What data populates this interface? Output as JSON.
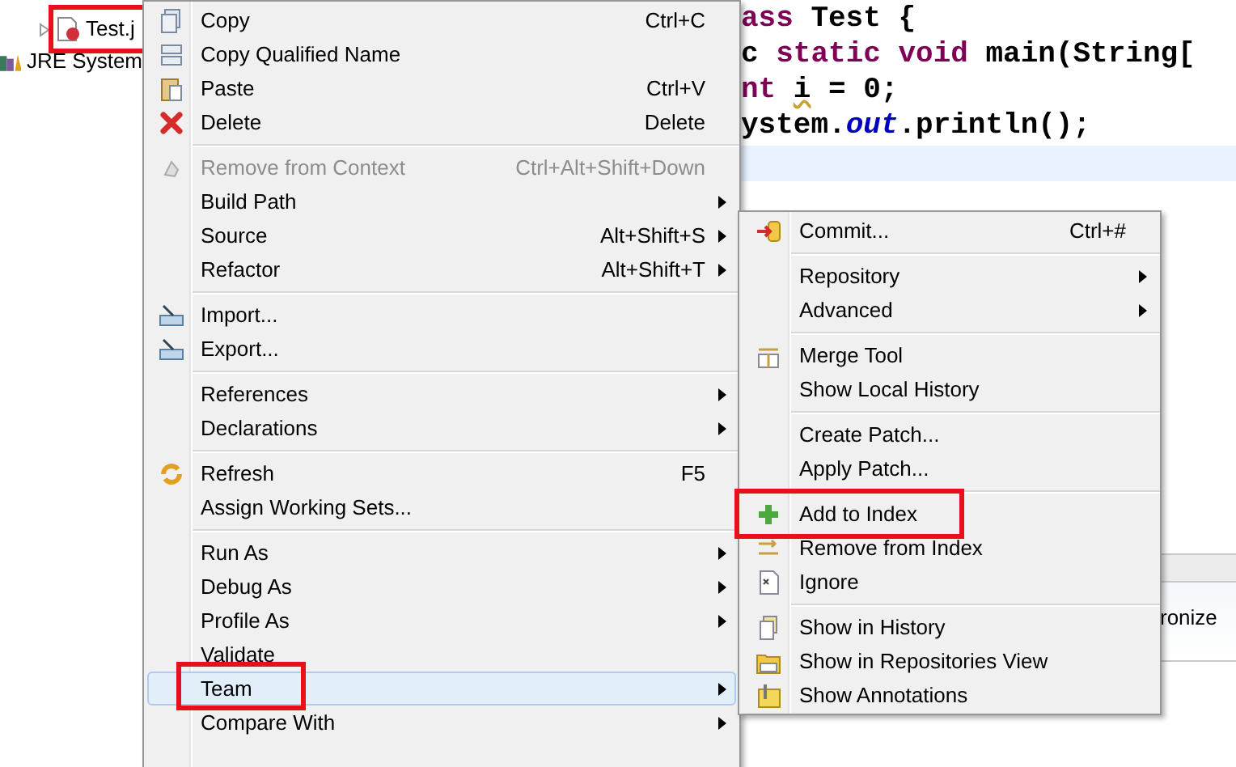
{
  "tree": {
    "items": [
      {
        "label": "Test.j",
        "annotated": true,
        "expandable": true
      },
      {
        "label": "JRE System",
        "annotated": false,
        "expandable": false
      }
    ]
  },
  "editor": {
    "lines": [
      {
        "current": false,
        "segments": [
          {
            "text": "ass",
            "kind": "keyword"
          },
          {
            "text": " Test {",
            "kind": "plain"
          }
        ]
      },
      {
        "current": false,
        "segments": [
          {
            "text": "c ",
            "kind": "plain"
          },
          {
            "text": "static void",
            "kind": "keyword"
          },
          {
            "text": " main(String[",
            "kind": "plain"
          }
        ]
      },
      {
        "current": false,
        "segments": [
          {
            "text": "nt ",
            "kind": "keyword"
          },
          {
            "text": "i",
            "kind": "warning"
          },
          {
            "text": " = 0;",
            "kind": "plain"
          }
        ]
      },
      {
        "current": false,
        "segments": [
          {
            "text": "ystem.",
            "kind": "plain"
          },
          {
            "text": "out",
            "kind": "field"
          },
          {
            "text": ".println();",
            "kind": "plain"
          }
        ]
      },
      {
        "current": true
      }
    ]
  },
  "bottom_panel": {
    "text": "ronize"
  },
  "context_menu": {
    "groups": [
      [
        {
          "label": "Copy",
          "shortcut": "Ctrl+C",
          "has_submenu": false,
          "disabled": false,
          "selected": false,
          "annotated": false
        },
        {
          "label": "Copy Qualified Name",
          "has_submenu": false,
          "disabled": false,
          "selected": false,
          "annotated": false
        },
        {
          "label": "Paste",
          "shortcut": "Ctrl+V",
          "has_submenu": false,
          "disabled": false,
          "selected": false,
          "annotated": false
        },
        {
          "label": "Delete",
          "shortcut": "Delete",
          "has_submenu": false,
          "disabled": false,
          "selected": false,
          "annotated": false
        }
      ],
      [
        {
          "label": "Remove from Context",
          "shortcut": "Ctrl+Alt+Shift+Down",
          "has_submenu": false,
          "disabled": true,
          "selected": false,
          "annotated": false
        },
        {
          "label": "Build Path",
          "has_submenu": true,
          "disabled": false,
          "selected": false,
          "annotated": false
        },
        {
          "label": "Source",
          "shortcut": "Alt+Shift+S",
          "has_submenu": true,
          "disabled": false,
          "selected": false,
          "annotated": false
        },
        {
          "label": "Refactor",
          "shortcut": "Alt+Shift+T",
          "has_submenu": true,
          "disabled": false,
          "selected": false,
          "annotated": false
        }
      ],
      [
        {
          "label": "Import...",
          "has_submenu": false,
          "disabled": false,
          "selected": false,
          "annotated": false
        },
        {
          "label": "Export...",
          "has_submenu": false,
          "disabled": false,
          "selected": false,
          "annotated": false
        }
      ],
      [
        {
          "label": "References",
          "has_submenu": true,
          "disabled": false,
          "selected": false,
          "annotated": false
        },
        {
          "label": "Declarations",
          "has_submenu": true,
          "disabled": false,
          "selected": false,
          "annotated": false
        }
      ],
      [
        {
          "label": "Refresh",
          "shortcut": "F5",
          "has_submenu": false,
          "disabled": false,
          "selected": false,
          "annotated": false
        },
        {
          "label": "Assign Working Sets...",
          "has_submenu": false,
          "disabled": false,
          "selected": false,
          "annotated": false
        }
      ],
      [
        {
          "label": "Run As",
          "has_submenu": true,
          "disabled": false,
          "selected": false,
          "annotated": false
        },
        {
          "label": "Debug As",
          "has_submenu": true,
          "disabled": false,
          "selected": false,
          "annotated": false
        },
        {
          "label": "Profile As",
          "has_submenu": true,
          "disabled": false,
          "selected": false,
          "annotated": false
        },
        {
          "label": "Validate",
          "has_submenu": false,
          "disabled": false,
          "selected": false,
          "annotated": false
        },
        {
          "label": "Team",
          "has_submenu": true,
          "disabled": false,
          "selected": true,
          "annotated": true
        },
        {
          "label": "Compare With",
          "has_submenu": true,
          "disabled": false,
          "selected": false,
          "annotated": false
        }
      ]
    ]
  },
  "team_submenu": {
    "groups": [
      [
        {
          "label": "Commit...",
          "shortcut": "Ctrl+#",
          "has_submenu": false,
          "annotated": false
        }
      ],
      [
        {
          "label": "Repository",
          "has_submenu": true,
          "annotated": false
        },
        {
          "label": "Advanced",
          "has_submenu": true,
          "annotated": false
        }
      ],
      [
        {
          "label": "Merge Tool",
          "has_submenu": false,
          "annotated": false
        },
        {
          "label": "Show Local History",
          "has_submenu": false,
          "annotated": false
        }
      ],
      [
        {
          "label": "Create Patch...",
          "has_submenu": false,
          "annotated": false
        },
        {
          "label": "Apply Patch...",
          "has_submenu": false,
          "annotated": false
        }
      ],
      [
        {
          "label": "Add to Index",
          "has_submenu": false,
          "annotated": true
        },
        {
          "label": "Remove from Index",
          "has_submenu": false,
          "annotated": false
        },
        {
          "label": "Ignore",
          "has_submenu": false,
          "annotated": false
        }
      ],
      [
        {
          "label": "Show in History",
          "has_submenu": false,
          "annotated": false
        },
        {
          "label": "Show in Repositories View",
          "has_submenu": false,
          "annotated": false
        },
        {
          "label": "Show Annotations",
          "has_submenu": false,
          "annotated": false
        }
      ]
    ]
  }
}
